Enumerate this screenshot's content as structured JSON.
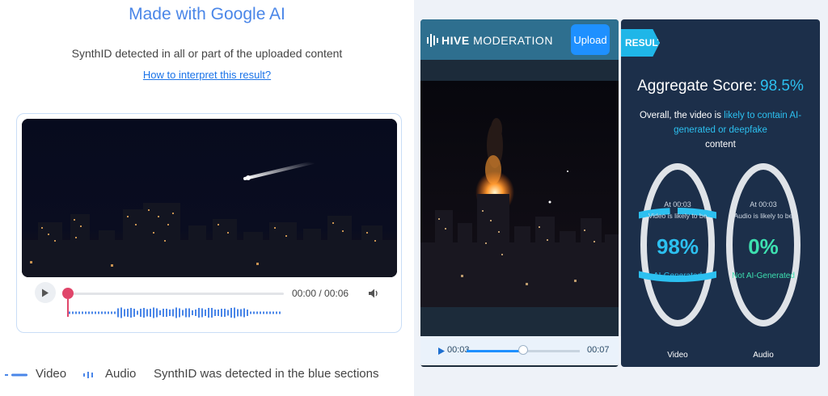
{
  "google": {
    "title": "Made with Google AI",
    "subtitle": "SynthID detected in all or part of the uploaded content",
    "link": "How to interpret this result?",
    "time": "00:00 / 00:06",
    "legend": {
      "video": "Video",
      "audio": "Audio",
      "note": "SynthID was detected in the blue sections"
    }
  },
  "hive": {
    "logo_bold": "HIVE",
    "logo_rest": "MODERATION",
    "upload": "Upload",
    "time_current": "00:03",
    "time_total": "00:07",
    "progress": 0.5
  },
  "result": {
    "tag": "RESULT",
    "aggregate_label": "Aggregate Score:",
    "aggregate_score": "98.5%",
    "overall_prefix": "Overall, the video is ",
    "overall_highlight": "likely to contain AI-generated or deepfake",
    "overall_suffix": "content",
    "video": {
      "at": "At 00:03",
      "likely": "Video is likely to be",
      "percent": "98%",
      "label": "AI-Generated",
      "caption": "Video",
      "value": 0.98,
      "color": "#2cc0f0"
    },
    "audio": {
      "at": "At 00:03",
      "likely": "Audio is likely to be",
      "percent": "0%",
      "label": "Not AI-Generated",
      "caption": "Audio",
      "value": 0.0,
      "color": "#3de0b0"
    }
  },
  "colors": {
    "google_blue": "#4a86e8",
    "link_blue": "#1a73e8",
    "playhead": "#e0466a",
    "hive_accent": "#1e90ff",
    "result_bg": "#1c2f4a"
  },
  "icons": {
    "play": "play-icon",
    "volume": "volume-icon",
    "hive_logo": "hive-logo-icon"
  }
}
